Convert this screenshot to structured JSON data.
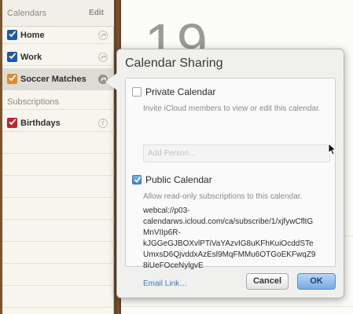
{
  "sidebar": {
    "header": "Calendars",
    "edit_label": "Edit",
    "items": [
      {
        "label": "Home",
        "color": "#1b5aa8"
      },
      {
        "label": "Work",
        "color": "#1b5aa8"
      },
      {
        "label": "Soccer Matches",
        "color": "#e08a2e"
      }
    ],
    "subscriptions_header": "Subscriptions",
    "subscriptions": [
      {
        "label": "Birthdays",
        "color": "#c2222b"
      }
    ]
  },
  "main": {
    "day_number": "19"
  },
  "popover": {
    "title": "Calendar Sharing",
    "private": {
      "label": "Private Calendar",
      "checked": false,
      "description": "Invite iCloud members to view or edit this calendar.",
      "add_person_placeholder": "Add Person..."
    },
    "public": {
      "label": "Public Calendar",
      "checked": true,
      "description": "Allow read-only subscriptions to this calendar.",
      "url_lines": [
        "webcal://p03-",
        "calendarws.icloud.com/ca/subscribe/1/xjfywCfltG",
        "MnVIIp6R-",
        "kJGGeGJBOXvlPTiVaYAzvIG8uKFhKuiOcddSTe",
        "UmxsD6QjvddxAzEsl9MqFMMu6OTGoEKFwqZ9",
        "8iUeFOceNylgvE"
      ],
      "email_link": "Email Link…"
    },
    "cancel_label": "Cancel",
    "ok_label": "OK"
  }
}
